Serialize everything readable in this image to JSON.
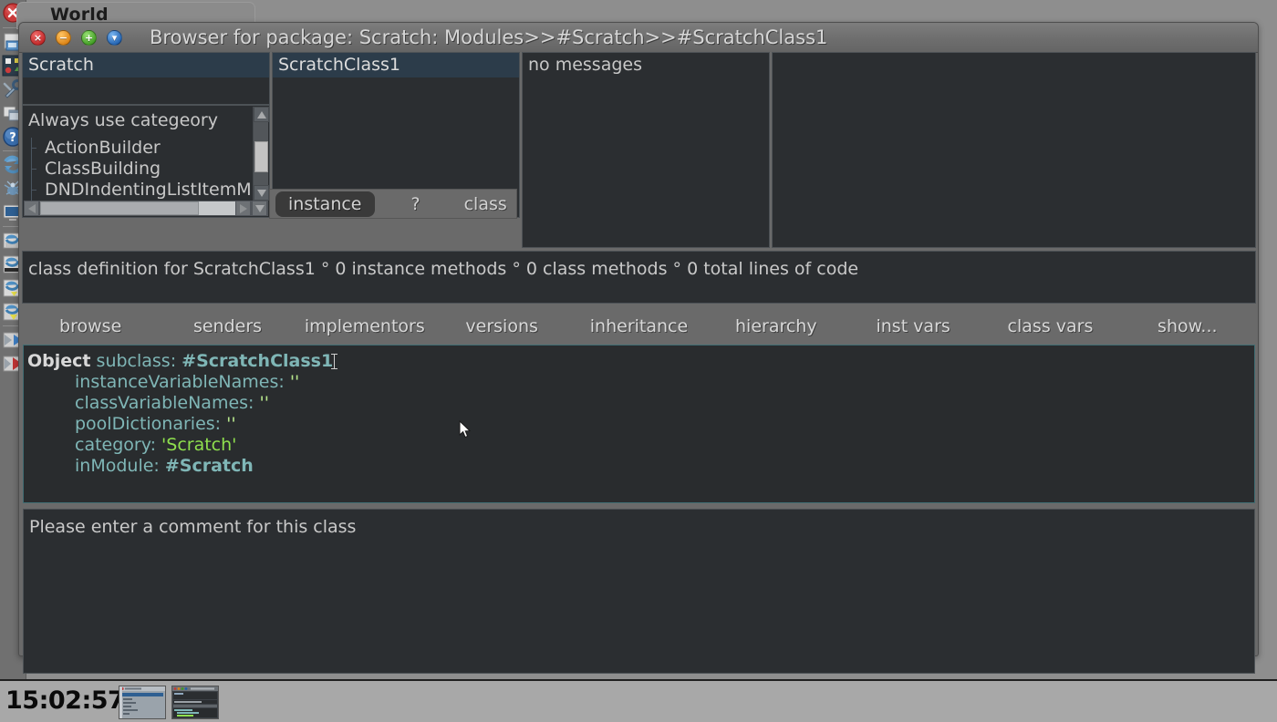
{
  "window": {
    "background_window_title": "World",
    "title": "Browser for package: Scratch: Modules>>#Scratch>>#ScratchClass1",
    "controls": [
      {
        "name": "close",
        "glyph": "×",
        "color": "#c02626"
      },
      {
        "name": "minimize",
        "glyph": "−",
        "color": "#d98012"
      },
      {
        "name": "maximize",
        "glyph": "+",
        "color": "#3f9b22"
      },
      {
        "name": "menu",
        "glyph": "▾",
        "color": "#1f5fae"
      }
    ]
  },
  "panes": {
    "packages": {
      "items": [
        {
          "label": "Scratch",
          "selected": true
        }
      ]
    },
    "categories": {
      "header": "Always use categeory",
      "items": [
        {
          "label": "ActionBuilder"
        },
        {
          "label": "ClassBuilding"
        },
        {
          "label": "DNDIndentingListItemM"
        }
      ]
    },
    "classes": {
      "items": [
        {
          "label": "ScratchClass1",
          "selected": true
        }
      ]
    },
    "messages": {
      "items": [
        {
          "label": "no messages"
        }
      ]
    },
    "protocols": {
      "items": []
    }
  },
  "switchbar": {
    "instance_label": "instance",
    "question_label": "?",
    "class_label": "class"
  },
  "infobar": {
    "text": "class definition for ScratchClass1 ° 0 instance methods ° 0 class methods ° 0 total lines of code"
  },
  "buttons": [
    {
      "label": "browse"
    },
    {
      "label": "senders"
    },
    {
      "label": "implementors"
    },
    {
      "label": "versions"
    },
    {
      "label": "inheritance"
    },
    {
      "label": "hierarchy"
    },
    {
      "label": "inst vars"
    },
    {
      "label": "class vars"
    },
    {
      "label": "show..."
    }
  ],
  "code": {
    "line1_obj": "Object",
    "line1_sel": " subclass: ",
    "line1_sym": "#ScratchClass1",
    "line2_key": "instanceVariableNames: ",
    "line2_val": "''",
    "line3_key": "classVariableNames: ",
    "line3_val": "''",
    "line4_key": "poolDictionaries: ",
    "line4_val": "''",
    "line5_key": "category: ",
    "line5_val": "'Scratch'",
    "line6_key": "inModule: ",
    "line6_val": "#Scratch"
  },
  "comment": {
    "text": "Please enter a comment for this class"
  },
  "taskbar": {
    "clock": "15:02:57",
    "thumbnails": [
      {
        "name": "world-window-thumbnail"
      },
      {
        "name": "browser-window-thumbnail"
      }
    ]
  },
  "dock": {
    "items": [
      {
        "name": "quit-icon"
      },
      {
        "name": "save-icon"
      },
      {
        "name": "apps-icon"
      },
      {
        "name": "tools-icon"
      },
      {
        "name": "windows-icon"
      },
      {
        "name": "help-icon"
      },
      {
        "name": "changes-icon"
      },
      {
        "name": "debug-icon"
      },
      {
        "name": "display-icon"
      },
      {
        "name": "update-icon"
      },
      {
        "name": "load-icon"
      },
      {
        "name": "publish-icon"
      },
      {
        "name": "export-icon"
      },
      {
        "name": "mail-icon"
      },
      {
        "name": "bookmark-icon"
      }
    ]
  },
  "colors": {
    "pane_bg": "#2b2e31",
    "window_chrome": "#6a6a6a",
    "selection": "#2c3c4a",
    "code_keyword": "#7fb6b6",
    "code_string": "#8fe04e",
    "taskbar": "#a8a8a8"
  }
}
